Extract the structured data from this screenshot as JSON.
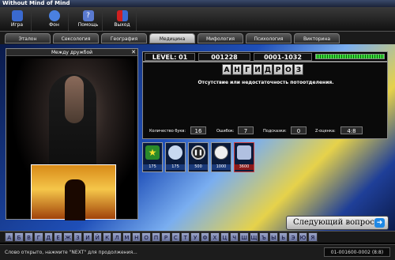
{
  "window": {
    "title": "Without Mind of Mind"
  },
  "toolbar": {
    "buttons": [
      {
        "label": "Игра",
        "icon": "game-icon"
      },
      {
        "label": "Фон",
        "icon": "background-icon"
      },
      {
        "label": "Помощь",
        "icon": "help-icon"
      },
      {
        "label": "Выход",
        "icon": "exit-icon"
      }
    ]
  },
  "tabs": [
    "Эталон",
    "Сексология",
    "География",
    "Медицина",
    "Мифология",
    "Психология",
    "Викторина"
  ],
  "active_tab": "Медицина",
  "left_panel": {
    "title": "Между дружбой"
  },
  "header": {
    "level": "LEVEL: 01",
    "score": "001228",
    "range": "0001-1032"
  },
  "word": [
    "А",
    "Н",
    "Г",
    "И",
    "Д",
    "Р",
    "О",
    "З"
  ],
  "question": "Отсутствие или недостаточность потоотделения.",
  "stats": {
    "letters_label": "Количество букв:",
    "letters_value": "16",
    "errors_label": "Ошибок:",
    "errors_value": "7",
    "hints_label": "Подсказки:",
    "hints_value": "0",
    "rating_label": "Z-оценка:",
    "rating_value": "4:8"
  },
  "hints": [
    {
      "icon": "star-icon",
      "cost": "175"
    },
    {
      "icon": "magnifier-icon",
      "cost": "175"
    },
    {
      "icon": "pause-icon",
      "cost": "500"
    },
    {
      "icon": "clock-icon",
      "cost": "1000"
    },
    {
      "icon": "shield-icon",
      "cost": "3600"
    }
  ],
  "next_button": "Следующий вопрос",
  "alphabet": [
    "А",
    "Б",
    "В",
    "Г",
    "Д",
    "Е",
    "Ж",
    "З",
    "И",
    "Й",
    "К",
    "Л",
    "М",
    "Н",
    "О",
    "П",
    "Р",
    "С",
    "Т",
    "У",
    "Ф",
    "Х",
    "Ц",
    "Ч",
    "Ш",
    "Щ",
    "Ъ",
    "Ы",
    "Ь",
    "Э",
    "Ю",
    "Я"
  ],
  "status": {
    "message": "Слово открыто, нажмите \"NEXT\" для продолжения...",
    "code": "01-001600-0002 (8:8)"
  },
  "colors": {
    "progress": "#3cdc3c",
    "accent": "#1e88e5"
  }
}
